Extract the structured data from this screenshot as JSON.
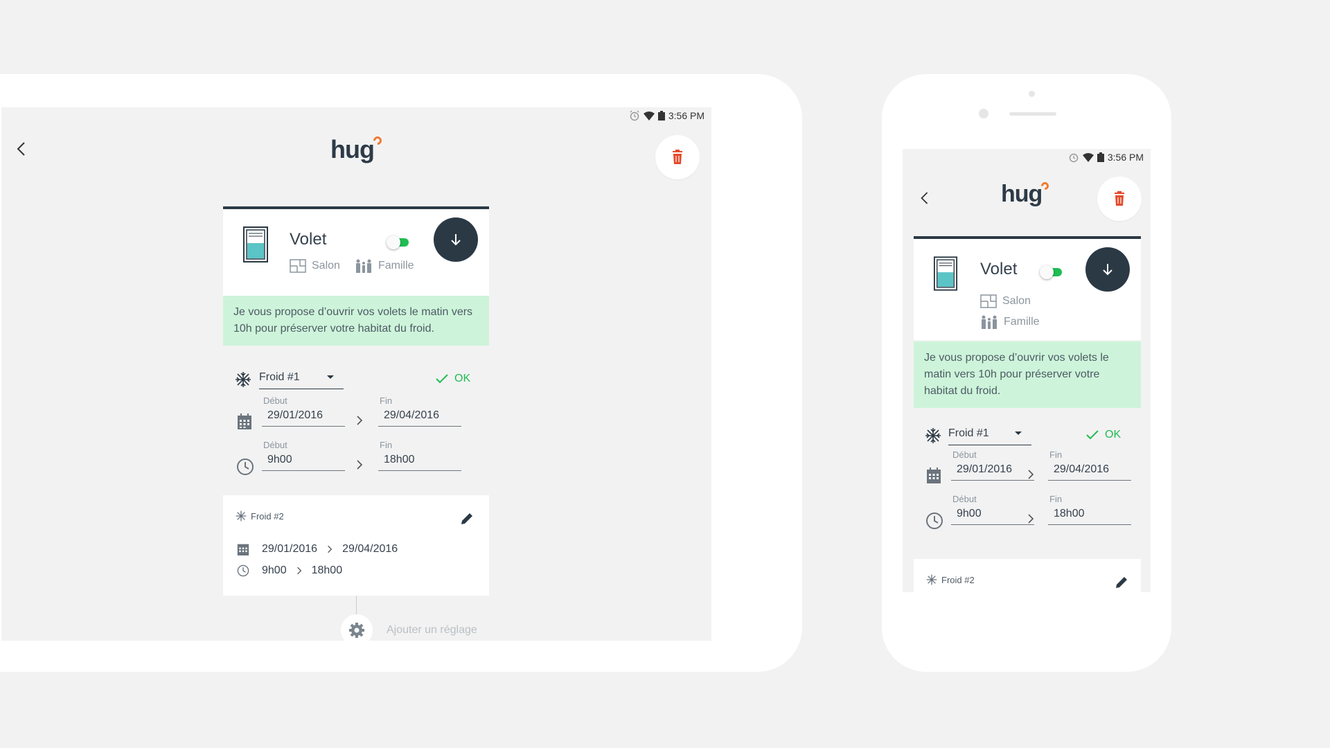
{
  "status_bar": {
    "time": "3:56 PM"
  },
  "header": {
    "logo": "hug"
  },
  "device": {
    "name": "Volet",
    "room": "Salon",
    "group": "Famille",
    "enabled": true
  },
  "suggestion": "Je vous propose d’ouvrir vos volets le matin vers 10h pour préserver votre habitat du froid.",
  "editor": {
    "preset_selected": "Froid #1",
    "ok_label": "OK",
    "date_start_label": "Début",
    "date_start": "29/01/2016",
    "date_end_label": "Fin",
    "date_end": "29/04/2016",
    "time_start_label": "Début",
    "time_start": "9h00",
    "time_end_label": "Fin",
    "time_end": "18h00"
  },
  "preset2": {
    "title": "Froid #2",
    "date_start": "29/01/2016",
    "date_end": "29/04/2016",
    "time_start": "9h00",
    "time_end": "18h00"
  },
  "add_setting_label": "Ajouter un réglage",
  "colors": {
    "accent_green": "#1fbd52",
    "dark": "#2b3945",
    "suggestion_bg": "#cdf4da",
    "delete_red": "#e44a2a",
    "logo_orange": "#f07a30"
  },
  "icons": [
    "alarm-icon",
    "wifi-icon",
    "battery-icon",
    "back-arrow-icon",
    "trash-icon",
    "window-icon",
    "arrow-down-icon",
    "room-icon",
    "family-icon",
    "snowflake-icon",
    "check-icon",
    "calendar-icon",
    "clock-icon",
    "chevron-right-icon",
    "pencil-icon",
    "gear-icon"
  ]
}
